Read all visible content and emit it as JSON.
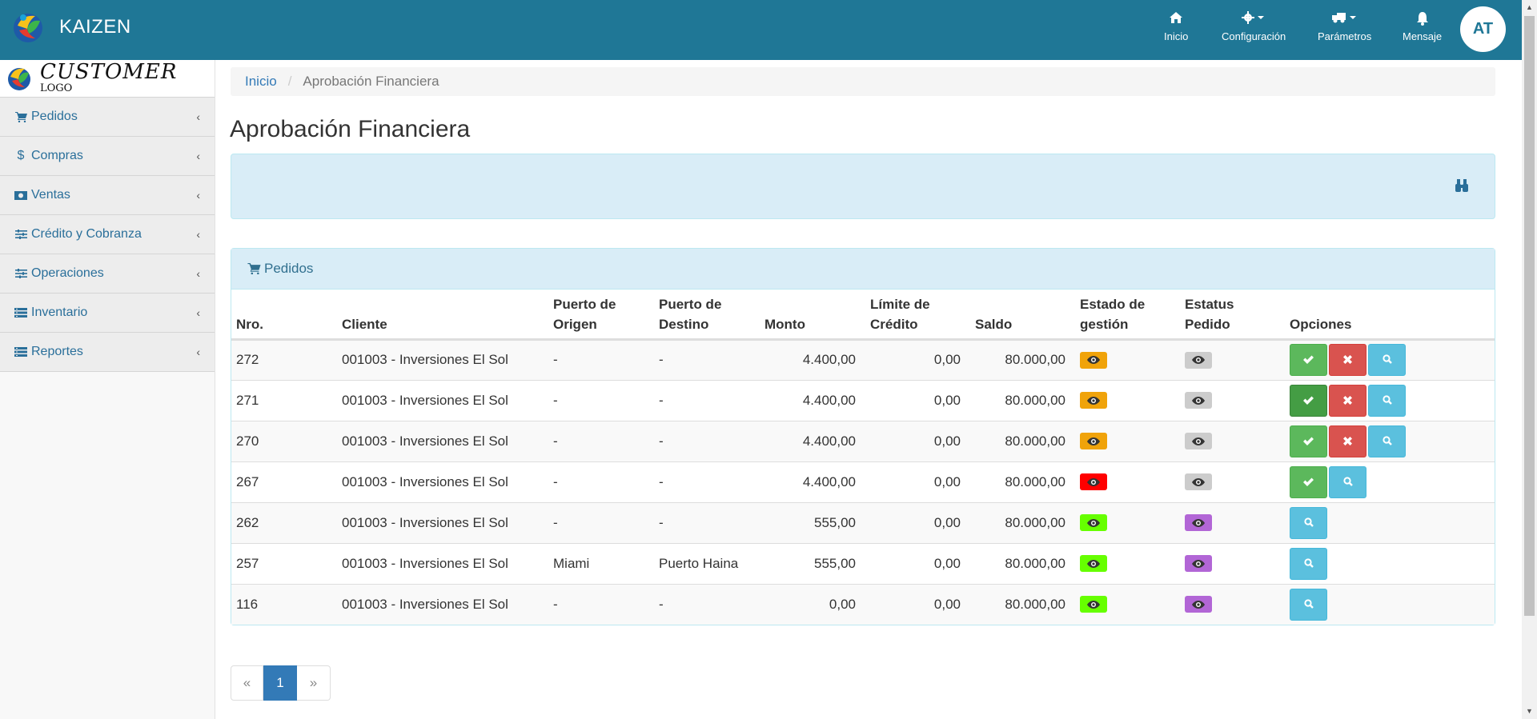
{
  "app": {
    "name": "KAIZEN"
  },
  "nav": [
    {
      "label": "Inicio",
      "icon": "home-icon"
    },
    {
      "label": "Configuración",
      "icon": "gear-icon"
    },
    {
      "label": "Parámetros",
      "icon": "truck-icon"
    },
    {
      "label": "Mensaje",
      "icon": "bell-icon"
    }
  ],
  "user": {
    "initials": "AT"
  },
  "customer_logo": {
    "main": "CUSTOMER",
    "sub": "LOGO"
  },
  "sidebar": {
    "items": [
      {
        "label": "Pedidos",
        "icon": "cart-icon"
      },
      {
        "label": "Compras",
        "icon": "dollar-icon"
      },
      {
        "label": "Ventas",
        "icon": "money-icon"
      },
      {
        "label": "Crédito y Cobranza",
        "icon": "sliders-icon"
      },
      {
        "label": "Operaciones",
        "icon": "sliders-icon"
      },
      {
        "label": "Inventario",
        "icon": "list-icon"
      },
      {
        "label": "Reportes",
        "icon": "list-icon"
      }
    ]
  },
  "breadcrumb": {
    "home": "Inicio",
    "current": "Aprobación Financiera"
  },
  "page": {
    "title": "Aprobación Financiera"
  },
  "panel": {
    "title": "Pedidos"
  },
  "table": {
    "headers": [
      "Nro.",
      "Cliente",
      "Puerto de Origen",
      "Puerto de Destino",
      "Monto",
      "Límite de Crédito",
      "Saldo",
      "Estado de gestión",
      "Estatus Pedido",
      "Opciones"
    ],
    "rows": [
      {
        "nro": "272",
        "cliente": "001003 - Inversiones El Sol",
        "origen": "-",
        "destino": "-",
        "monto": "4.400,00",
        "limite": "0,00",
        "saldo": "80.000,00",
        "estado_color": "#f0a30a",
        "estatus_color": "#cccccc",
        "actions": [
          "approve",
          "reject",
          "view"
        ]
      },
      {
        "nro": "271",
        "cliente": "001003 - Inversiones El Sol",
        "origen": "-",
        "destino": "-",
        "monto": "4.400,00",
        "limite": "0,00",
        "saldo": "80.000,00",
        "estado_color": "#f0a30a",
        "estatus_color": "#cccccc",
        "actions": [
          "approve-active",
          "reject",
          "view"
        ]
      },
      {
        "nro": "270",
        "cliente": "001003 - Inversiones El Sol",
        "origen": "-",
        "destino": "-",
        "monto": "4.400,00",
        "limite": "0,00",
        "saldo": "80.000,00",
        "estado_color": "#f0a30a",
        "estatus_color": "#cccccc",
        "actions": [
          "approve",
          "reject",
          "view"
        ]
      },
      {
        "nro": "267",
        "cliente": "001003 - Inversiones El Sol",
        "origen": "-",
        "destino": "-",
        "monto": "4.400,00",
        "limite": "0,00",
        "saldo": "80.000,00",
        "estado_color": "#ff0000",
        "estatus_color": "#cccccc",
        "actions": [
          "approve",
          "view"
        ]
      },
      {
        "nro": "262",
        "cliente": "001003 - Inversiones El Sol",
        "origen": "-",
        "destino": "-",
        "monto": "555,00",
        "limite": "0,00",
        "saldo": "80.000,00",
        "estado_color": "#66ff00",
        "estatus_color": "#b266d6",
        "actions": [
          "view"
        ]
      },
      {
        "nro": "257",
        "cliente": "001003 - Inversiones El Sol",
        "origen": "Miami",
        "destino": "Puerto Haina",
        "monto": "555,00",
        "limite": "0,00",
        "saldo": "80.000,00",
        "estado_color": "#66ff00",
        "estatus_color": "#b266d6",
        "actions": [
          "view"
        ]
      },
      {
        "nro": "116",
        "cliente": "001003 - Inversiones El Sol",
        "origen": "-",
        "destino": "-",
        "monto": "0,00",
        "limite": "0,00",
        "saldo": "80.000,00",
        "estado_color": "#66ff00",
        "estatus_color": "#b266d6",
        "actions": [
          "view"
        ]
      }
    ]
  },
  "pagination": {
    "prev": "«",
    "current": "1",
    "next": "»"
  },
  "colors": {
    "navbar": "#1f7796",
    "approve": "#5cb85c",
    "reject": "#d9534f",
    "view": "#5bc0de",
    "page_active": "#337ab7"
  }
}
